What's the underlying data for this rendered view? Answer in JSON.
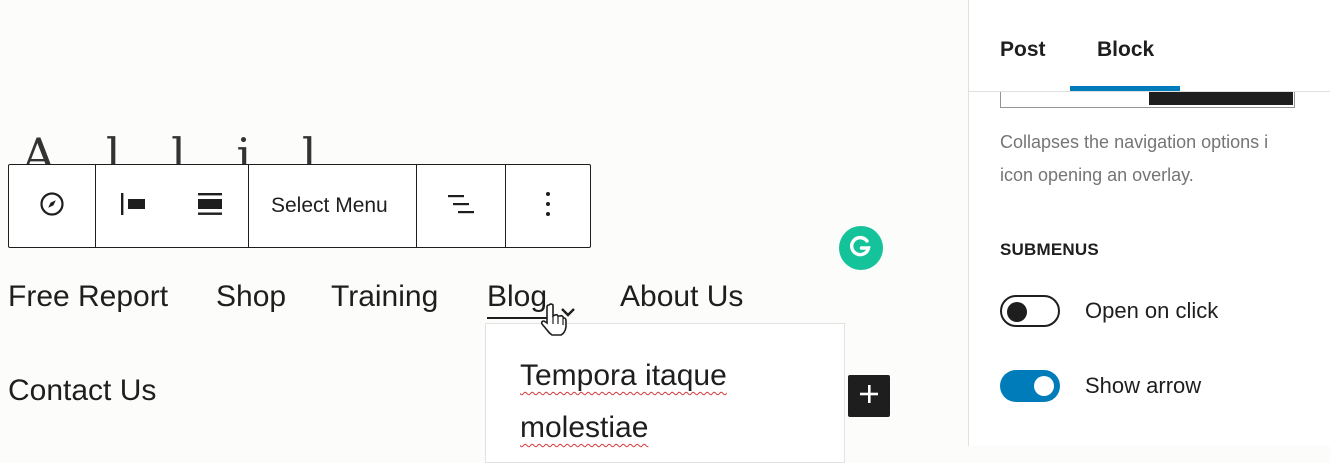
{
  "editor": {
    "site_title_fragment": "A l l i l",
    "toolbar": {
      "select_menu_label": "Select Menu"
    },
    "nav_items": [
      "Free Report",
      "Shop",
      "Training",
      "Blog",
      "About Us",
      "Contact Us"
    ],
    "submenu": {
      "item_line1": "Tempora itaque",
      "item_line2": "molestiae"
    }
  },
  "sidebar": {
    "tabs": [
      "Post",
      "Block"
    ],
    "active_tab": "Block",
    "help_text": "Collapses the navigation options i\nicon opening an overlay.",
    "submenus_heading": "SUBMENUS",
    "toggles": [
      {
        "label": "Open on click",
        "checked": false
      },
      {
        "label": "Show arrow",
        "checked": true
      }
    ]
  },
  "colors": {
    "accent": "#007cba",
    "grammarly": "#15c39a",
    "spellcheck": "#d63638"
  }
}
